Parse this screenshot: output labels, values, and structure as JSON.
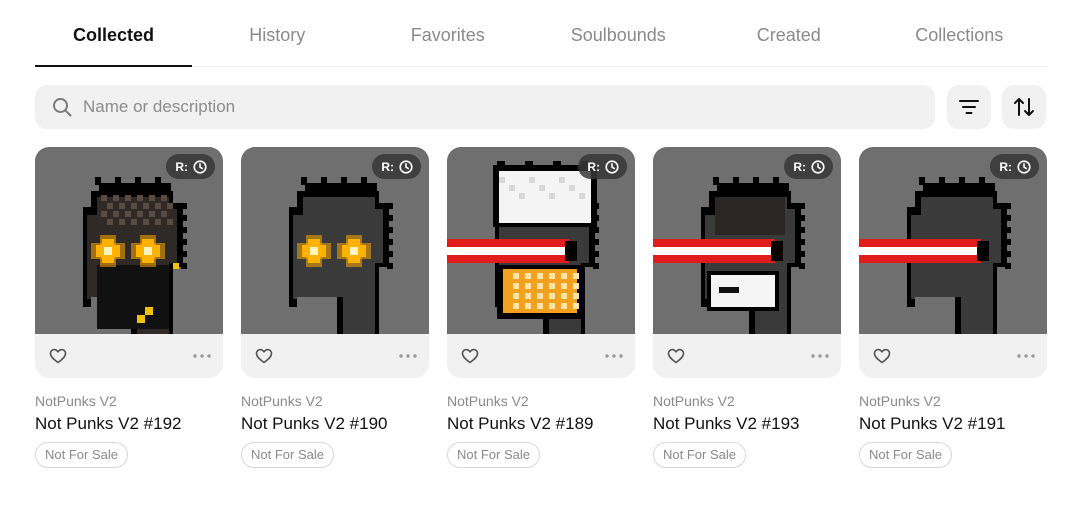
{
  "tabs": [
    {
      "label": "Collected",
      "active": true
    },
    {
      "label": "History",
      "active": false
    },
    {
      "label": "Favorites",
      "active": false
    },
    {
      "label": "Soulbounds",
      "active": false
    },
    {
      "label": "Created",
      "active": false
    },
    {
      "label": "Collections",
      "active": false
    }
  ],
  "search": {
    "placeholder": "Name or description",
    "icon": "search-icon"
  },
  "toolbar": {
    "filter_icon": "filter-icon",
    "sort_icon": "sort-icon"
  },
  "colors": {
    "card_bg": "#f1f1f2",
    "image_bg": "#6f6f6f",
    "muted_text": "#8a8a8a",
    "accent_text": "#111111"
  },
  "cards": [
    {
      "collection": "NotPunks V2",
      "title": "Not Punks V2 #192",
      "status": "Not For Sale",
      "badge": "R:",
      "variant": "glow-eyes-beard"
    },
    {
      "collection": "NotPunks V2",
      "title": "Not Punks V2 #190",
      "status": "Not For Sale",
      "badge": "R:",
      "variant": "glow-eyes"
    },
    {
      "collection": "NotPunks V2",
      "title": "Not Punks V2 #189",
      "status": "Not For Sale",
      "badge": "R:",
      "variant": "laser-white-hair"
    },
    {
      "collection": "NotPunks V2",
      "title": "Not Punks V2 #193",
      "status": "Not For Sale",
      "badge": "R:",
      "variant": "laser-mask"
    },
    {
      "collection": "NotPunks V2",
      "title": "Not Punks V2 #191",
      "status": "Not For Sale",
      "badge": "R:",
      "variant": "laser"
    }
  ]
}
